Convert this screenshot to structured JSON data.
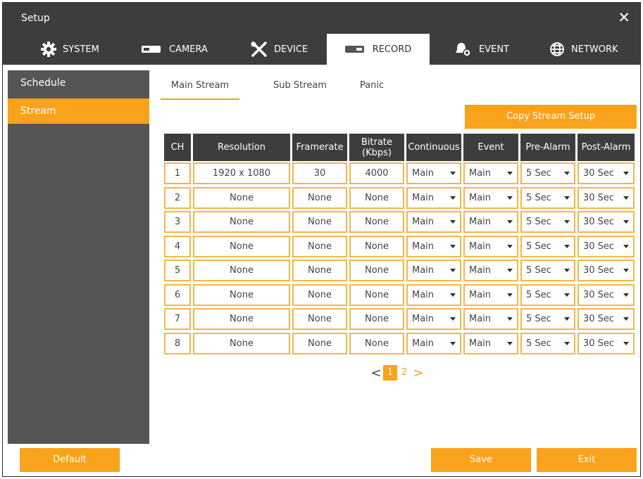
{
  "window": {
    "title": "Setup",
    "close_symbol": "✕"
  },
  "tabs": [
    {
      "label": "SYSTEM",
      "icon": "gear-icon"
    },
    {
      "label": "CAMERA",
      "icon": "camera-icon"
    },
    {
      "label": "DEVICE",
      "icon": "tools-icon"
    },
    {
      "label": "RECORD",
      "icon": "record-icon",
      "active": true
    },
    {
      "label": "EVENT",
      "icon": "bell-icon"
    },
    {
      "label": "NETWORK",
      "icon": "globe-icon"
    }
  ],
  "sidebar": {
    "items": [
      {
        "label": "Schedule"
      },
      {
        "label": "Stream",
        "active": true
      }
    ]
  },
  "subtabs": [
    {
      "label": "Main Stream",
      "active": true
    },
    {
      "label": "Sub Stream"
    },
    {
      "label": "Panic"
    }
  ],
  "copy_button": "Copy Stream Setup",
  "table": {
    "headers": [
      "CH",
      "Resolution",
      "Framerate",
      "Bitrate\n(Kbps)",
      "Continuous",
      "Event",
      "Pre-Alarm",
      "Post-Alarm"
    ],
    "rows": [
      [
        "1",
        "1920 x 1080",
        "30",
        "4000",
        "Main",
        "Main",
        "5 Sec",
        "30 Sec"
      ],
      [
        "2",
        "None",
        "None",
        "None",
        "Main",
        "Main",
        "5 Sec",
        "30 Sec"
      ],
      [
        "3",
        "None",
        "None",
        "None",
        "Main",
        "Main",
        "5 Sec",
        "30 Sec"
      ],
      [
        "4",
        "None",
        "None",
        "None",
        "Main",
        "Main",
        "5 Sec",
        "30 Sec"
      ],
      [
        "5",
        "None",
        "None",
        "None",
        "Main",
        "Main",
        "5 Sec",
        "30 Sec"
      ],
      [
        "6",
        "None",
        "None",
        "None",
        "Main",
        "Main",
        "5 Sec",
        "30 Sec"
      ],
      [
        "7",
        "None",
        "None",
        "None",
        "Main",
        "Main",
        "5 Sec",
        "30 Sec"
      ],
      [
        "8",
        "None",
        "None",
        "None",
        "Main",
        "Main",
        "5 Sec",
        "30 Sec"
      ]
    ]
  },
  "pagination": {
    "prev": "<",
    "pages": [
      "1",
      "2"
    ],
    "current": "1",
    "next": ">"
  },
  "buttons": {
    "default": "Default",
    "save": "Save",
    "exit": "Exit"
  },
  "colors": {
    "accent": "#f9a21b",
    "dark": "#3d3d3d",
    "sidebar": "#555555",
    "cell_border": "#f3b64c"
  }
}
